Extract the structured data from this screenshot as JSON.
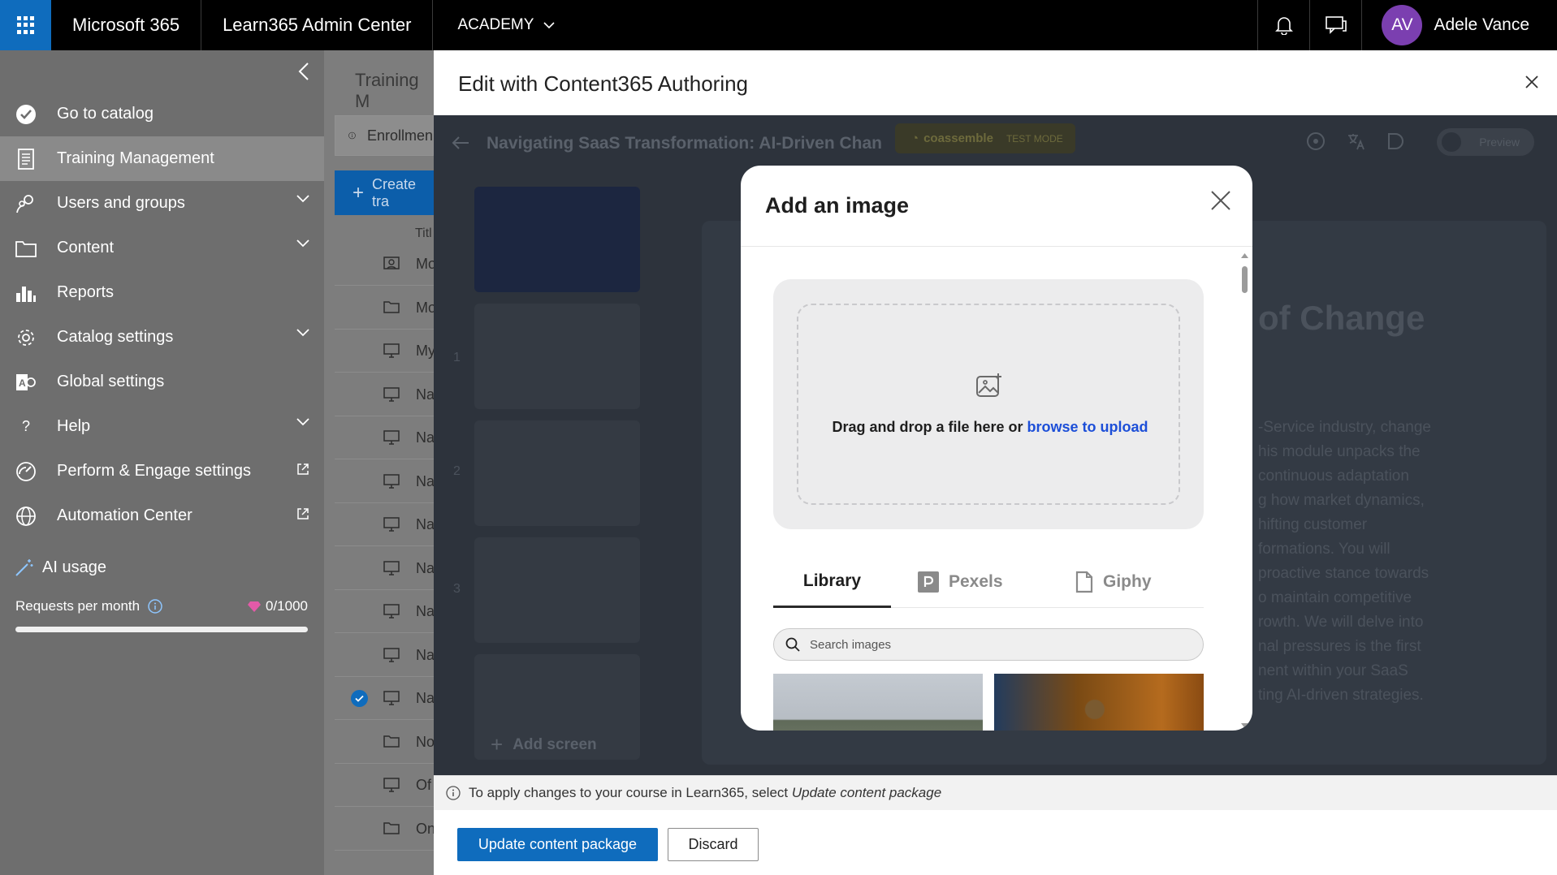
{
  "topbar": {
    "brand": "Microsoft 365",
    "app": "Learn365 Admin Center",
    "workspace": "ACADEMY",
    "user_initials": "AV",
    "user_name": "Adele Vance"
  },
  "sidebar": {
    "items": [
      {
        "label": "Go to catalog",
        "icon": "check-circle-icon"
      },
      {
        "label": "Training Management",
        "icon": "document-icon",
        "active": true
      },
      {
        "label": "Users and groups",
        "icon": "users-icon",
        "expandable": true
      },
      {
        "label": "Content",
        "icon": "folder-icon",
        "expandable": true
      },
      {
        "label": "Reports",
        "icon": "bar-chart-icon"
      },
      {
        "label": "Catalog settings",
        "icon": "gear-icon",
        "expandable": true
      },
      {
        "label": "Global settings",
        "icon": "global-settings-icon"
      },
      {
        "label": "Help",
        "icon": "question-icon",
        "expandable": true
      },
      {
        "label": "Perform & Engage settings",
        "icon": "gauge-icon",
        "external": true
      },
      {
        "label": "Automation Center",
        "icon": "globe-icon",
        "external": true
      }
    ],
    "ai_usage": {
      "label": "AI usage",
      "requests_label": "Requests per month",
      "requests_value": "0/1000",
      "usage_fraction": 0
    }
  },
  "middle": {
    "title": "Training M",
    "enrollment": "Enrollmen",
    "create_button": "Create tra",
    "column_header": "Titl",
    "rows": [
      {
        "icon": "person-board-icon",
        "text": "Mo",
        "checked": false
      },
      {
        "icon": "folder-icon",
        "text": "Mo",
        "checked": false
      },
      {
        "icon": "monitor-icon",
        "text": "My",
        "checked": false
      },
      {
        "icon": "monitor-icon",
        "text": "Na",
        "checked": false
      },
      {
        "icon": "monitor-icon",
        "text": "Na",
        "checked": false
      },
      {
        "icon": "monitor-icon",
        "text": "Na",
        "checked": false
      },
      {
        "icon": "monitor-icon",
        "text": "Na",
        "checked": false
      },
      {
        "icon": "monitor-icon",
        "text": "Na",
        "checked": false
      },
      {
        "icon": "monitor-icon",
        "text": "Na",
        "checked": false
      },
      {
        "icon": "monitor-icon",
        "text": "Na",
        "checked": false
      },
      {
        "icon": "monitor-icon",
        "text": "Na",
        "checked": true
      },
      {
        "icon": "folder-icon",
        "text": "No",
        "checked": false
      },
      {
        "icon": "monitor-icon",
        "text": "Of",
        "checked": false
      },
      {
        "icon": "folder-icon",
        "text": "On",
        "checked": false
      }
    ]
  },
  "panel": {
    "title": "Edit with Content365 Authoring",
    "course_title": "Navigating SaaS Transformation: AI-Driven Chan",
    "badge_brand": "coassemble",
    "badge_mode": "TEST MODE",
    "preview_label": "Preview",
    "add_screen": "Add screen",
    "slide_title_fragment": "of Change",
    "slide_text_lines": [
      "-Service industry, change",
      "his module unpacks the",
      "continuous adaptation",
      "g how market dynamics,",
      "hifting customer",
      "formations. You will",
      "proactive stance towards",
      "o maintain competitive",
      "rowth. We will delve into",
      "nal pressures is the first",
      "nent within your SaaS",
      "ting AI-driven strategies."
    ],
    "slide_numbers": [
      "1",
      "2",
      "3"
    ],
    "info_text": "To apply changes to your course in Learn365, select ",
    "info_emphasis": "Update content package",
    "update_button": "Update content package",
    "discard_button": "Discard"
  },
  "modal": {
    "title": "Add an image",
    "drop_text": "Drag and drop a file here or ",
    "drop_link": "browse to upload",
    "tabs": [
      {
        "label": "Library",
        "active": true
      },
      {
        "label": "Pexels",
        "active": false
      },
      {
        "label": "Giphy",
        "active": false
      }
    ],
    "search_placeholder": "Search images"
  },
  "colors": {
    "accent": "#0f6cbd",
    "avatar": "#7b3fb0",
    "link": "#1d4fd8"
  }
}
